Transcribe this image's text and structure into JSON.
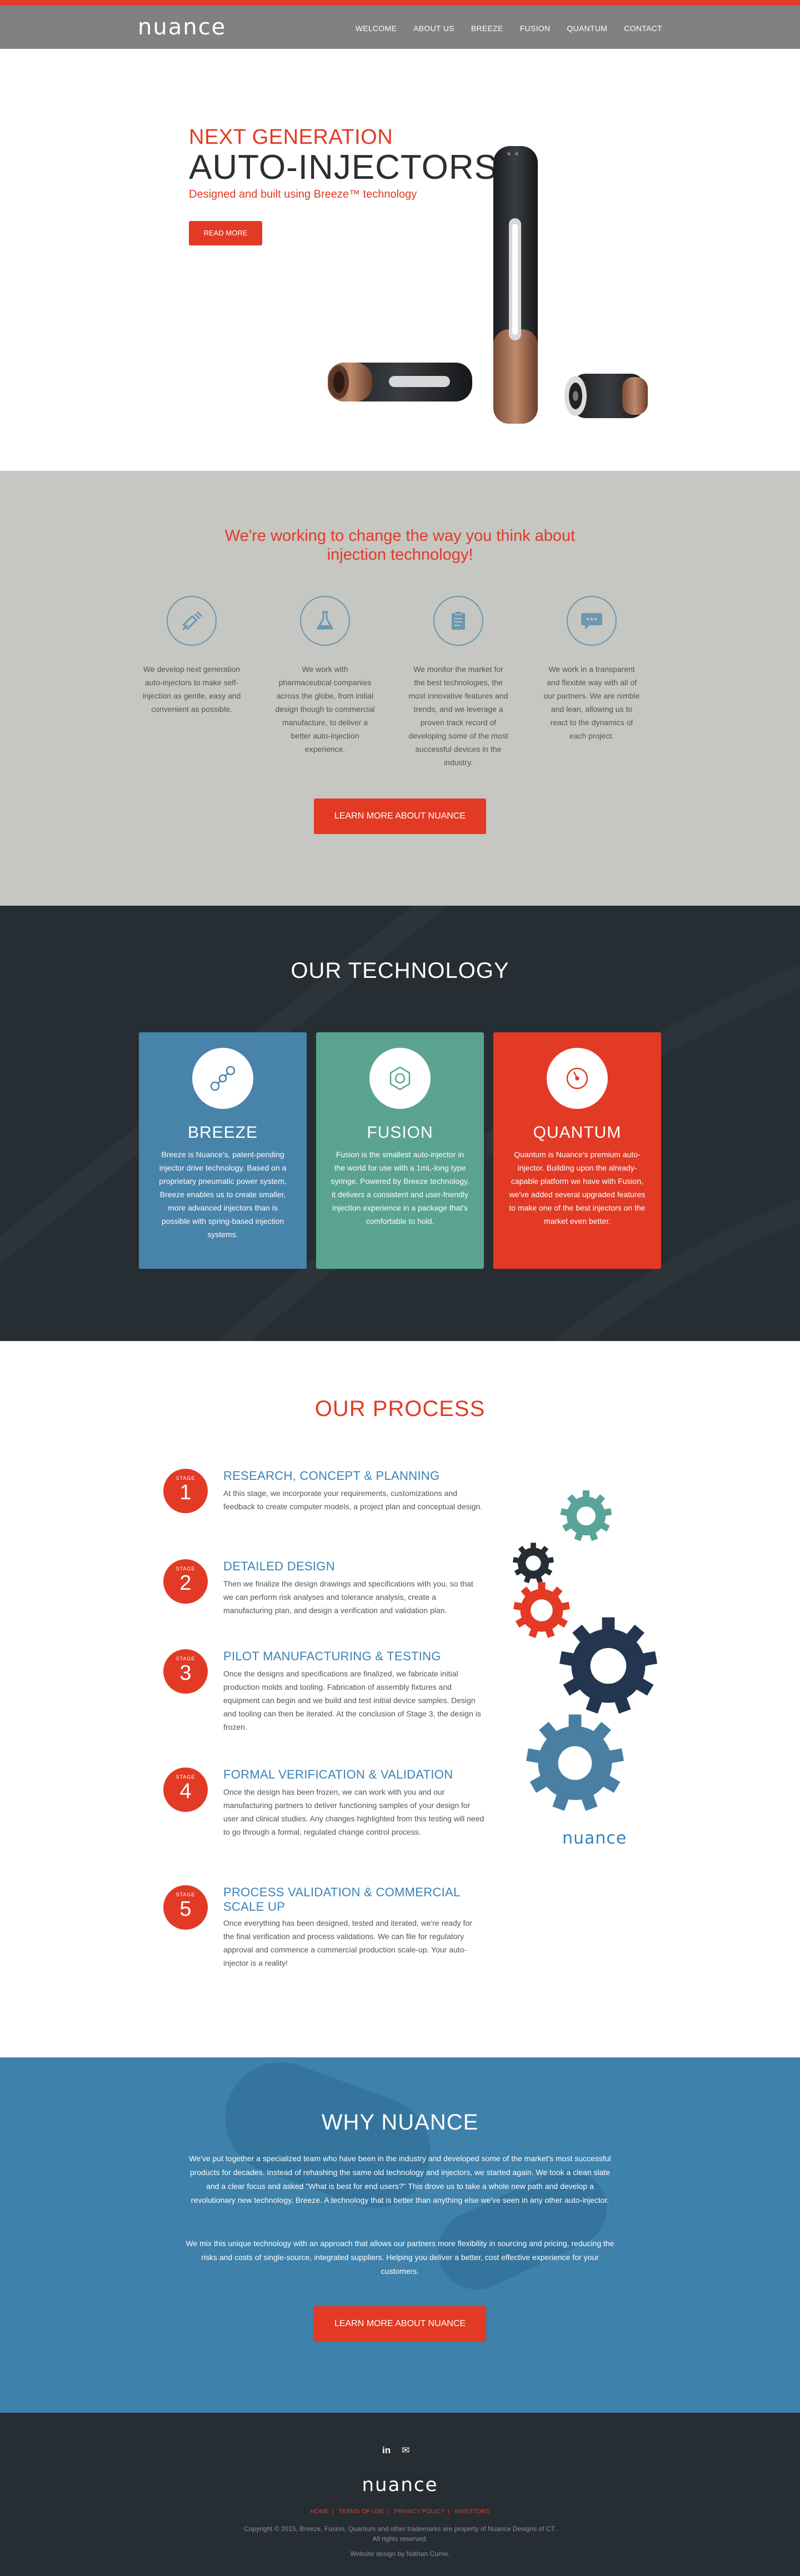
{
  "brand": "nuance",
  "nav": [
    "WELCOME",
    "ABOUT US",
    "BREEZE",
    "FUSION",
    "QUANTUM",
    "CONTACT"
  ],
  "hero": {
    "kicker": "NEXT GENERATION",
    "title": "AUTO-INJECTORS",
    "subtitle": "Designed and built using Breeze™ technology",
    "button": "READ MORE"
  },
  "working": {
    "heading_line1": "We're working to change the way you think about",
    "heading_line2": "injection technology!",
    "columns": [
      {
        "icon": "syringe-icon",
        "text": "We develop next generation auto-injectors to make self-injection as gentle, easy and convenient as possible."
      },
      {
        "icon": "flask-icon",
        "text": "We work with pharmaceutical companies across the globe, from initial design though to commercial manufacture, to deliver a better auto-injection experience."
      },
      {
        "icon": "clipboard-icon",
        "text": "We monitor the market for the best technologies, the most innovative features and trends, and we leverage a proven track record of developing some of the most successful devices in the industry."
      },
      {
        "icon": "chat-icon",
        "text": "We work in a transparent and flexible way with all of our partners. We are nimble and lean, allowing us to react to the dynamics of each project."
      }
    ],
    "button": "LEARN MORE ABOUT NUANCE"
  },
  "technology": {
    "heading": "OUR TECHNOLOGY",
    "cards": [
      {
        "title": "BREEZE",
        "color": "#4883aa",
        "icon": "molecule-icon",
        "text": "Breeze is Nuance's, patent-pending injector drive technology. Based on a proprietary pneumatic power system, Breeze enables us to create smaller, more advanced injectors than is possible with spring-based injection systems."
      },
      {
        "title": "FUSION",
        "color": "#5aa391",
        "icon": "hex-nut-icon",
        "text": "Fusion is the smallest auto-injector in the world for use with a 1mL-long type syringe. Powered by Breeze technology, it delivers a consistent and user-friendly injection experience in a package that's comfortable to hold."
      },
      {
        "title": "QUANTUM",
        "color": "#e23a25",
        "icon": "gauge-icon",
        "text": "Quantum is Nuance's premium auto-injector. Building upon the already-capable platform we have with Fusion, we've added several upgraded features to make one of the best injectors on the market even better."
      }
    ]
  },
  "process": {
    "heading": "OUR PROCESS",
    "stage_label": "STAGE",
    "stages": [
      {
        "num": "1",
        "title": "RESEARCH, CONCEPT & PLANNING",
        "text": "At this stage, we incorporate your requirements, customizations and feedback to create computer models, a project plan and conceptual design."
      },
      {
        "num": "2",
        "title": "DETAILED DESIGN",
        "text": "Then we finalize the design drawings and specifications with you, so that we can perform risk analyses and tolerance analysis, create a manufacturing plan, and design a verification and validation plan."
      },
      {
        "num": "3",
        "title": "PILOT MANUFACTURING & TESTING",
        "text": "Once the designs and specifications are finalized, we fabricate initial production molds and tooling. Fabrication of assembly fixtures and equipment can begin and we build and test initial device samples. Design and tooling can then be iterated. At the conclusion of Stage 3, the design is frozen."
      },
      {
        "num": "4",
        "title": "FORMAL VERIFICATION & VALIDATION",
        "text": "Once the design has been frozen, we can work with you and our manufacturing partners to deliver functioning samples of your design for user and clinical studies. Any changes highlighted from this testing will need to go through a formal, regulated change control process."
      },
      {
        "num": "5",
        "title": "PROCESS VALIDATION & COMMERCIAL SCALE UP",
        "text": "Once everything has been designed, tested and iterated, we're ready for the final verification and process validations. We can file for regulatory approval and commence a commercial production scale-up. Your auto-injector is a reality!"
      }
    ],
    "gears_brand": "nuance"
  },
  "why": {
    "heading": "WHY NUANCE",
    "para1": "We've put together a specialized team who have been in the industry and developed some of the market's most successful products for decades. Instead of rehashing the same old technology and injectors, we started again. We took a clean slate and a clear focus and asked \"What is best for end users?\" This drove us to take a whole new path and develop a revolutionary new technology, Breeze. A technology that is better than anything else we've seen in any other auto-injector.",
    "para2": "We mix this unique technology with an approach that allows our partners more flexibility in sourcing and pricing, reducing the risks and costs of single-source, integrated suppliers. Helping you deliver a better, cost effective experience for your customers.",
    "button": "LEARN MORE ABOUT NUANCE"
  },
  "footer": {
    "social": [
      "in",
      "✉"
    ],
    "brand": "nuance",
    "links": [
      "HOME",
      "TERMS OF USE",
      "PRIVACY POLICY",
      "INVESTORS"
    ],
    "copyright": "Copyright © 2015, Breeze, Fusion, Quantum and other trademarks are property of Nuance Designs of CT.",
    "rights": "All rights reserved.",
    "credit": "Website design by Nathan Currie."
  }
}
